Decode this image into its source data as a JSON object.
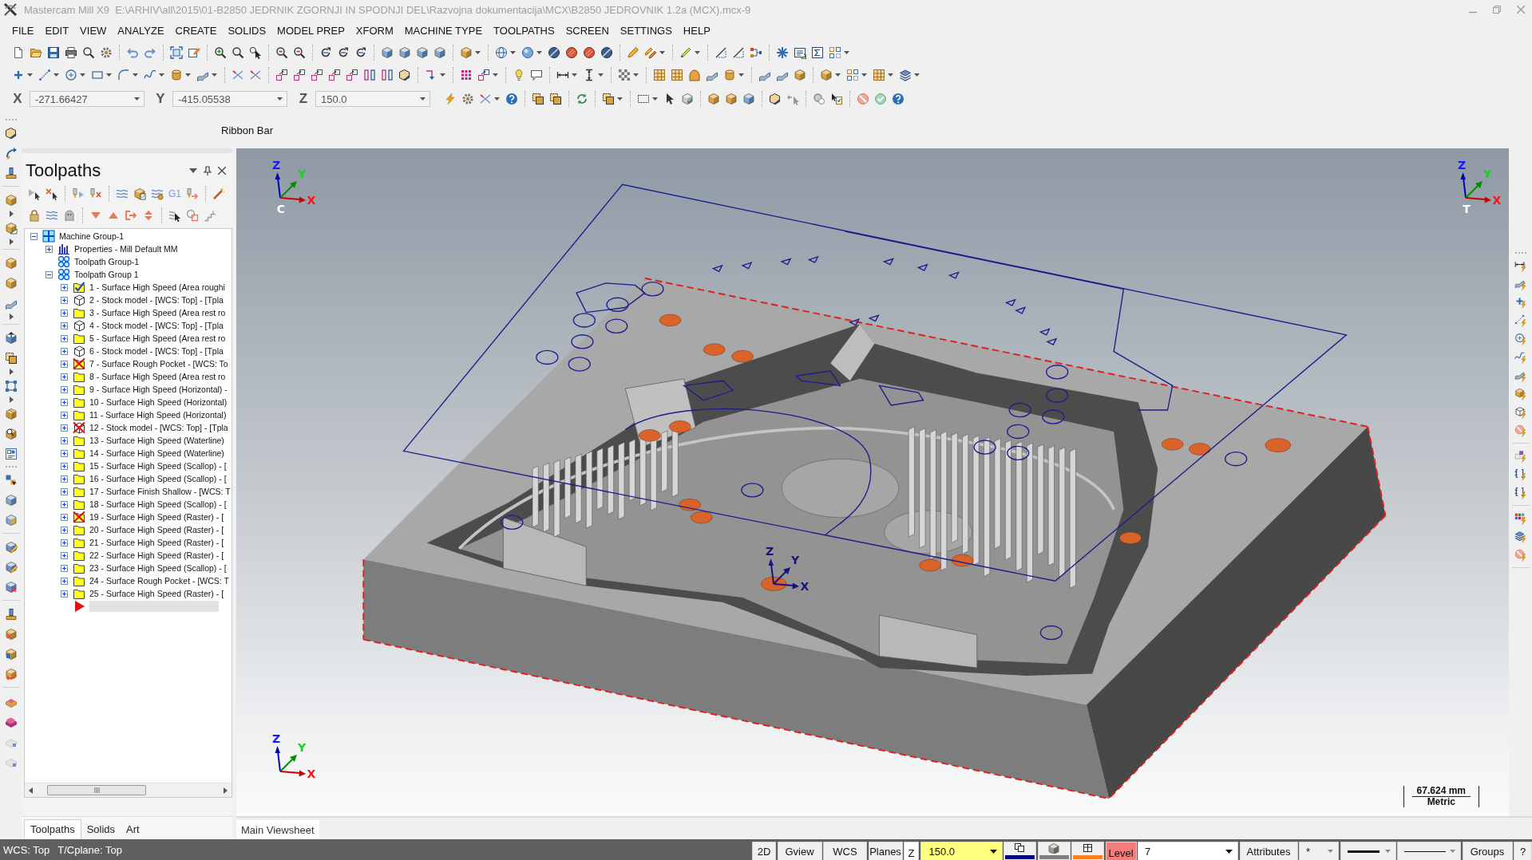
{
  "window": {
    "title": "Mastercam Mill X9  E:\\ARHIV\\all\\2015\\01-B2850 JEDRNIK ZGORNJI IN SPODNJI DEL\\Razvojna dokumentacija\\MCX\\B2850 JEDROVNIK 1.2a (MCX).mcx-9"
  },
  "menu": [
    "FILE",
    "EDIT",
    "VIEW",
    "ANALYZE",
    "CREATE",
    "SOLIDS",
    "MODEL PREP",
    "XFORM",
    "MACHINE TYPE",
    "TOOLPATHS",
    "SCREEN",
    "SETTINGS",
    "HELP"
  ],
  "coordinates": [
    {
      "axis": "X",
      "value": "-271.66427"
    },
    {
      "axis": "Y",
      "value": "-415.05538"
    },
    {
      "axis": "Z",
      "value": "150.0"
    }
  ],
  "ribbon_bar": {
    "label": "Ribbon Bar"
  },
  "toolpaths_panel": {
    "title": "Toolpaths",
    "g_code_button": "G1",
    "tree": [
      {
        "label": "Machine Group-1",
        "kind": "machine",
        "expanded": true,
        "selected": false,
        "children": [
          {
            "label": "Properties - Mill Default MM",
            "kind": "properties",
            "expanded": false,
            "selected": false
          },
          {
            "label": "Toolpath Group-1",
            "kind": "group",
            "selected": false
          },
          {
            "label": "Toolpath Group 1",
            "kind": "group",
            "expanded": true,
            "selected": false,
            "children": [
              {
                "label": "1 - Surface High Speed (Area roughi",
                "kind": "folder",
                "expanded": false,
                "selected": true,
                "dirty": false
              },
              {
                "label": "2 - Stock model - [WCS: Top] - [Tpla",
                "kind": "stock",
                "expanded": false,
                "selected": false,
                "dirty": false
              },
              {
                "label": "3 - Surface High Speed (Area rest ro",
                "kind": "folder",
                "expanded": false,
                "selected": false,
                "dirty": false
              },
              {
                "label": "4 - Stock model - [WCS: Top] - [Tpla",
                "kind": "stock",
                "expanded": false,
                "selected": false,
                "dirty": false
              },
              {
                "label": "5 - Surface High Speed (Area rest ro",
                "kind": "folder",
                "expanded": false,
                "selected": false,
                "dirty": false
              },
              {
                "label": "6 - Stock model - [WCS: Top] - [Tpla",
                "kind": "stock",
                "expanded": false,
                "selected": false,
                "dirty": false
              },
              {
                "label": "7 - Surface Rough Pocket - [WCS: To",
                "kind": "folder",
                "expanded": false,
                "selected": false,
                "dirty": true
              },
              {
                "label": "8 - Surface High Speed (Area rest ro",
                "kind": "folder",
                "expanded": false,
                "selected": false,
                "dirty": false
              },
              {
                "label": "9 - Surface High Speed (Horizontal) -",
                "kind": "folder",
                "expanded": false,
                "selected": false,
                "dirty": false
              },
              {
                "label": "10 - Surface High Speed (Horizontal)",
                "kind": "folder",
                "expanded": false,
                "selected": false,
                "dirty": false
              },
              {
                "label": "11 - Surface High Speed (Horizontal)",
                "kind": "folder",
                "expanded": false,
                "selected": false,
                "dirty": false
              },
              {
                "label": "12 - Stock model - [WCS: Top] - [Tpla",
                "kind": "stock",
                "expanded": false,
                "selected": false,
                "dirty": true
              },
              {
                "label": "13 - Surface High Speed (Waterline)",
                "kind": "folder",
                "expanded": false,
                "selected": false,
                "dirty": false
              },
              {
                "label": "14 - Surface High Speed (Waterline)",
                "kind": "folder",
                "expanded": false,
                "selected": false,
                "dirty": false
              },
              {
                "label": "15 - Surface High Speed (Scallop) - [",
                "kind": "folder",
                "expanded": false,
                "selected": false,
                "dirty": false
              },
              {
                "label": "16 - Surface High Speed (Scallop) - [",
                "kind": "folder",
                "expanded": false,
                "selected": false,
                "dirty": false
              },
              {
                "label": "17 - Surface Finish Shallow - [WCS: T",
                "kind": "folder",
                "expanded": false,
                "selected": false,
                "dirty": false
              },
              {
                "label": "18 - Surface High Speed (Scallop) - [",
                "kind": "folder",
                "expanded": false,
                "selected": false,
                "dirty": false
              },
              {
                "label": "19 - Surface High Speed (Raster) - [",
                "kind": "folder",
                "expanded": false,
                "selected": false,
                "dirty": true
              },
              {
                "label": "20 - Surface High Speed (Raster) - [",
                "kind": "folder",
                "expanded": false,
                "selected": false,
                "dirty": false
              },
              {
                "label": "21 - Surface High Speed (Raster) - [",
                "kind": "folder",
                "expanded": false,
                "selected": false,
                "dirty": false
              },
              {
                "label": "22 - Surface High Speed (Raster) - [",
                "kind": "folder",
                "expanded": false,
                "selected": false,
                "dirty": false
              },
              {
                "label": "23 - Surface High Speed (Scallop) - [",
                "kind": "folder",
                "expanded": false,
                "selected": false,
                "dirty": false
              },
              {
                "label": "24 - Surface Rough Pocket - [WCS: T",
                "kind": "folder",
                "expanded": false,
                "selected": false,
                "dirty": false
              },
              {
                "label": "25 - Surface High Speed (Raster) - [",
                "kind": "folder",
                "expanded": false,
                "selected": false,
                "dirty": false
              }
            ]
          }
        ]
      }
    ],
    "tabs": [
      {
        "label": "Toolpaths",
        "selected": true
      },
      {
        "label": "Solids",
        "selected": false
      },
      {
        "label": "Art",
        "selected": false
      }
    ]
  },
  "viewport": {
    "triads": [
      {
        "kind": "colored",
        "z": "Z",
        "y": "Y",
        "x": "X",
        "origin": "C"
      },
      {
        "kind": "colored",
        "z": "Z",
        "y": "Y",
        "x": "X",
        "origin": "T"
      },
      {
        "kind": "plain",
        "z": "Z",
        "y": "Y",
        "x": "X"
      },
      {
        "kind": "colored",
        "z": "Z",
        "y": "Y",
        "x": "X"
      }
    ],
    "scale_bar": {
      "length": "67.624 mm",
      "units": "Metric"
    },
    "tabs": [
      {
        "label": "Main Viewsheet",
        "selected": true
      }
    ]
  },
  "status_bar": {
    "wcs": "WCS: Top",
    "planes": "T/Cplane: Top",
    "buttons": [
      "2D",
      "Gview",
      "WCS",
      "Planes"
    ],
    "z_label": "Z",
    "z_value": "150.0",
    "color_buttons": [
      {
        "color": "#00007f"
      },
      {
        "color": "#7f7f7f"
      },
      {
        "color": "#ff7f27"
      }
    ],
    "level_label": "Level",
    "level_value": "7",
    "attributes_button": "Attributes",
    "point_style": "*",
    "groups_button": "Groups",
    "help_button": "?"
  }
}
